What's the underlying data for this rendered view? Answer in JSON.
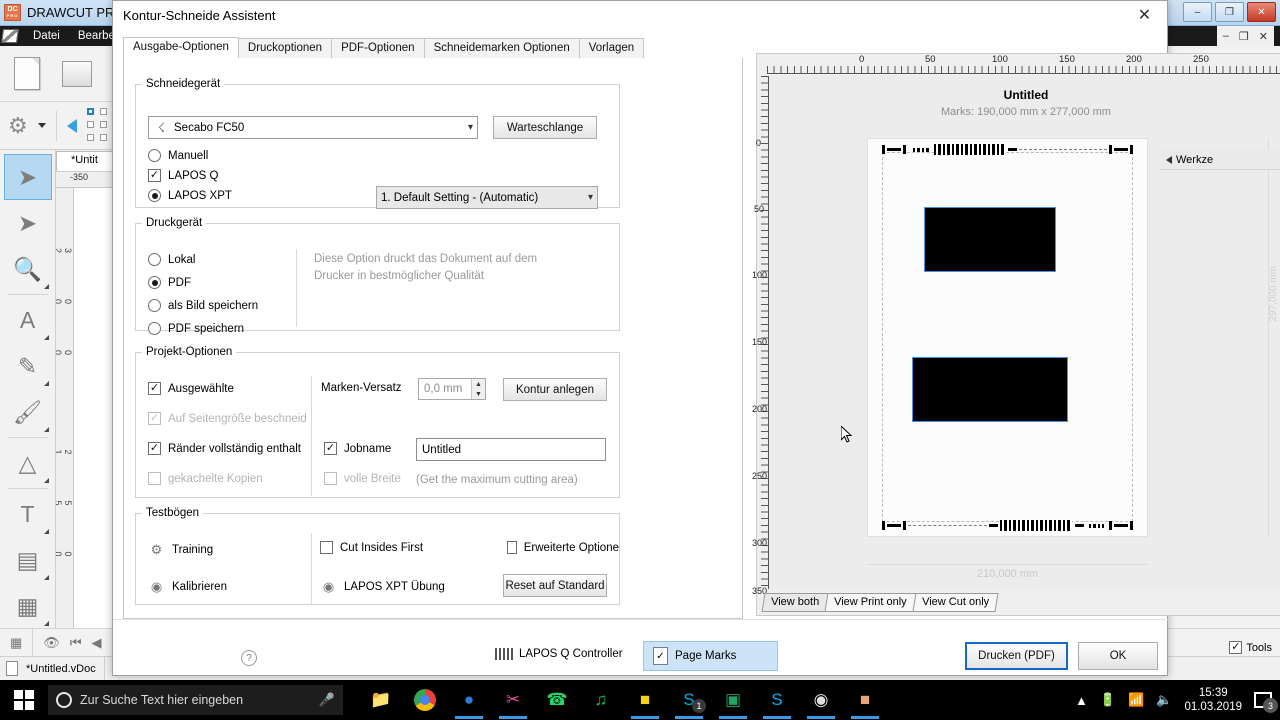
{
  "app": {
    "title": "DRAWCUT PRO",
    "logo_text": "DC",
    "logo_sub": "PRO",
    "menu": [
      "Datei",
      "Bearbeit"
    ],
    "doc_tab": "*Untit",
    "ruler_origin": "-350",
    "right_panel_header": "Werkze",
    "status_doc": "*Untitled.vDoc",
    "tools_label": "Tools",
    "window_controls": {
      "minimize": "–",
      "maximize": "❐",
      "close": "✕"
    },
    "mini_controls": {
      "minimize": "–",
      "restore": "❐",
      "close": "✕"
    }
  },
  "dialog": {
    "title": "Kontur-Schneide Assistent",
    "close": "✕",
    "tabs": [
      {
        "label": "Ausgabe-Optionen",
        "active": true
      },
      {
        "label": "Druckoptionen",
        "active": false
      },
      {
        "label": "PDF-Optionen",
        "active": false
      },
      {
        "label": "Schneidemarken Optionen",
        "active": false
      },
      {
        "label": "Vorlagen",
        "active": false
      }
    ],
    "cutting_device": {
      "legend": "Schneidegerät",
      "device_value": "Secabo FC50",
      "queue_button": "Warteschlange",
      "options": [
        {
          "label": "Manuell",
          "type": "radio",
          "checked": false
        },
        {
          "label": "LAPOS Q",
          "type": "checkbox",
          "checked": true
        },
        {
          "label": "LAPOS XPT",
          "type": "radio",
          "checked": true
        }
      ],
      "setting_value": "1. Default Setting - (Automatic)"
    },
    "print_device": {
      "legend": "Druckgerät",
      "options": [
        {
          "label": "Lokal",
          "checked": false
        },
        {
          "label": "PDF",
          "checked": true
        },
        {
          "label": "als Bild speichern",
          "checked": false
        },
        {
          "label": "PDF speichern",
          "checked": false
        }
      ],
      "hint_line1": "Diese Option druckt das Dokument auf dem",
      "hint_line2": "Drucker in bestmöglicher Qualität"
    },
    "project_options": {
      "legend": "Projekt-Optionen",
      "checks": [
        {
          "label": "Ausgewählte",
          "checked": true,
          "disabled": false
        },
        {
          "label": "Auf Seitengröße beschneid",
          "checked": true,
          "disabled": true
        },
        {
          "label": "Ränder vollständig enthalt",
          "checked": true,
          "disabled": false
        },
        {
          "label": "gekachelte Kopien",
          "checked": false,
          "disabled": true
        }
      ],
      "marks_offset_label": "Marken-Versatz",
      "marks_offset_value": "0,0 mm",
      "contour_button": "Kontur anlegen",
      "jobname_label": "Jobname",
      "jobname_checked": true,
      "jobname_value": "Untitled",
      "full_width_label": "volle Breite",
      "full_width_checked": false,
      "full_width_hint": "(Get the maximum cutting area)"
    },
    "test_sheets": {
      "legend": "Testbögen",
      "training": "Training",
      "calibrate": "Kalibrieren",
      "cut_insides_first": "Cut Insides First",
      "cut_insides_first_checked": false,
      "lapos_practice": "LAPOS XPT Übung",
      "advanced_options": "Erweiterte Optione",
      "advanced_options_checked": false,
      "reset_button": "Reset auf Standard"
    },
    "footer": {
      "lapos_controller": "LAPOS Q Controller",
      "page_marks": "Page Marks",
      "print_button": "Drucken (PDF)",
      "ok_button": "OK",
      "help": "?"
    },
    "preview": {
      "title": "Untitled",
      "marks_info": "Marks: 190,000 mm x 277,000 mm",
      "width_label": "210,000 mm",
      "height_label": "297,000 mm",
      "ruler_ticks": [
        "0",
        "50",
        "100",
        "150",
        "200",
        "250"
      ],
      "ruler_ticks_left": [
        "0",
        "50",
        "100",
        "150",
        "200",
        "250",
        "300",
        "350"
      ],
      "view_tabs": [
        {
          "label": "View both",
          "active": true
        },
        {
          "label": "View Print only",
          "active": false
        },
        {
          "label": "View Cut only",
          "active": false
        }
      ]
    }
  },
  "taskbar": {
    "search_placeholder": "Zur Suche Text hier eingeben",
    "time": "15:39",
    "date": "01.03.2019",
    "notification_count": "3",
    "skype_badge": "1",
    "apps": [
      "file-explorer",
      "chrome",
      "edge",
      "paint",
      "whatsapp",
      "spotify",
      "notes",
      "skype",
      "excel",
      "skype2",
      "obs",
      "drawcut"
    ]
  },
  "colors": {
    "accent": "#1569c7",
    "selection": "#b5d9f2",
    "titlebar": "#b9d4ef"
  }
}
